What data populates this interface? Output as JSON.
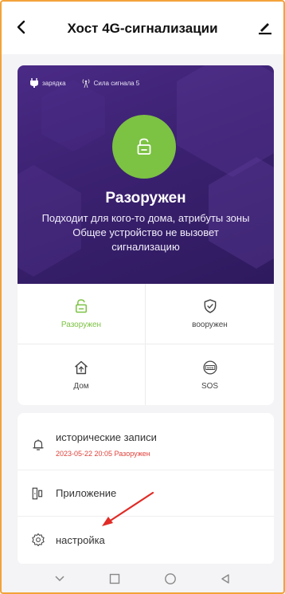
{
  "header": {
    "title": "Хост 4G-сигнализации",
    "back_icon": "chevron-left-icon",
    "edit_icon": "edit-icon"
  },
  "hero": {
    "charge_label": "зарядка",
    "signal_label": "Сила сигнала 5",
    "lock_icon": "unlock-icon",
    "state_title": "Разоружен",
    "state_desc": "Подходит для кого-то дома, атрибуты зоны Общее устройство не вызовет сигнализацию",
    "accent_color": "#7cc243"
  },
  "modes": [
    {
      "label": "Разоружен",
      "icon": "unlock-icon",
      "active": true
    },
    {
      "label": "вооружен",
      "icon": "shield-check-icon",
      "active": false
    },
    {
      "label": "Дом",
      "icon": "home-icon",
      "active": false
    },
    {
      "label": "SOS",
      "icon": "sos-icon",
      "active": false
    }
  ],
  "menu": {
    "history_label": "исторические записи",
    "history_sub": "2023-05-22 20:05 Разоружен",
    "app_label": "Приложение",
    "settings_label": "настройка"
  },
  "navbar": {
    "items": [
      "chevron-down-icon",
      "square-icon",
      "circle-icon",
      "triangle-back-icon"
    ]
  }
}
